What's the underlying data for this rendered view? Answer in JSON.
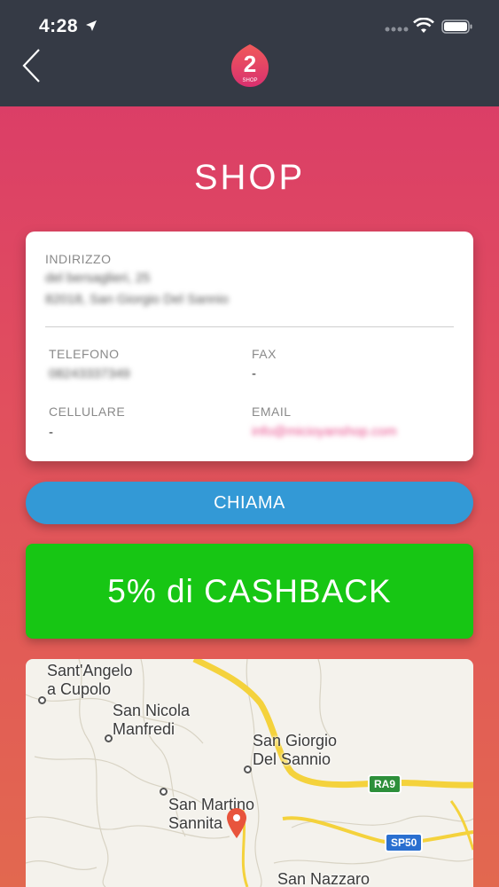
{
  "status_bar": {
    "time": "4:28"
  },
  "header": {
    "logo_number": "2",
    "logo_text": "SHOP"
  },
  "page_title": "SHOP",
  "card": {
    "address_label": "INDIRIZZO",
    "address_line1": "del bersaglieri, 25",
    "address_line2": "82018, San Giorgio Del Sannio",
    "phone_label": "TELEFONO",
    "phone_value": "08243337349",
    "fax_label": "FAX",
    "fax_value": "-",
    "mobile_label": "CELLULARE",
    "mobile_value": "-",
    "email_label": "EMAIL",
    "email_value": "info@micioyanshop.com"
  },
  "call_button": "CHIAMA",
  "cashback": "5% di CASHBACK",
  "map": {
    "places": [
      {
        "line1": "Sant'Angelo",
        "line2": "a Cupolo"
      },
      {
        "line1": "San Nicola",
        "line2": "Manfredi"
      },
      {
        "line1": "San Giorgio",
        "line2": "Del Sannio"
      },
      {
        "line1": "San Martino",
        "line2": "Sannita"
      },
      {
        "line1": "San Nazzaro",
        "line2": ""
      }
    ],
    "roads": [
      "RA9",
      "SP50"
    ],
    "accent_color": "#e8543c"
  }
}
